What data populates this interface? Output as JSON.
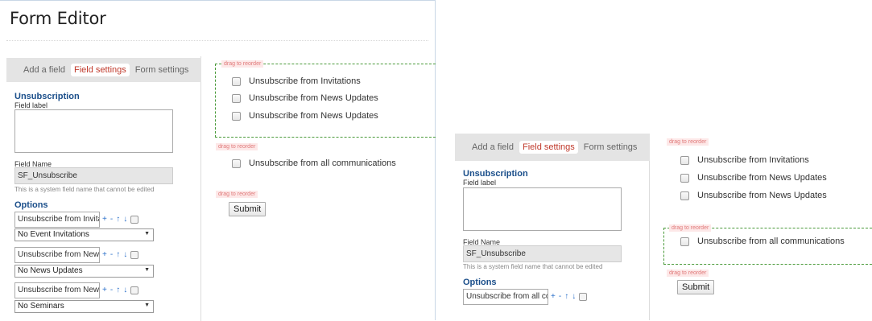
{
  "left": {
    "title": "Form Editor",
    "tabs": [
      "Add a field",
      "Field settings",
      "Form settings"
    ],
    "section": "Unsubscription",
    "field_label_label": "Field label",
    "field_name_label": "Field Name",
    "field_name_value": "SF_Unsubscribe",
    "field_name_hint": "This is a system field name that cannot be edited",
    "options_label": "Options",
    "options": [
      {
        "input": "Unsubscribe from Invitati",
        "select": "No Event Invitations"
      },
      {
        "input": "Unsubscribe from News",
        "select": "No News Updates"
      },
      {
        "input": "Unsubscribe from News",
        "select": "No Seminars"
      }
    ],
    "ctrl_plus": "+",
    "ctrl_minus": "-",
    "ctrl_up": "↑",
    "ctrl_down": "↓",
    "drag_label": "drag to reorder",
    "group_items": [
      "Unsubscribe from Invitations",
      "Unsubscribe from News Updates",
      "Unsubscribe from News Updates"
    ],
    "single_item": "Unsubscribe from all communications",
    "submit": "Submit"
  },
  "right": {
    "tabs": [
      "Add a field",
      "Field settings",
      "Form settings"
    ],
    "section": "Unsubscription",
    "field_label_label": "Field label",
    "field_name_label": "Field Name",
    "field_name_value": "SF_Unsubscribe",
    "field_name_hint": "This is a system field name that cannot be edited",
    "options_label": "Options",
    "option_input": "Unsubscribe from all cor",
    "drag_label": "drag to reorder",
    "group_items": [
      "Unsubscribe from Invitations",
      "Unsubscribe from News Updates",
      "Unsubscribe from News Updates"
    ],
    "single_item": "Unsubscribe from all communications",
    "submit": "Submit"
  }
}
